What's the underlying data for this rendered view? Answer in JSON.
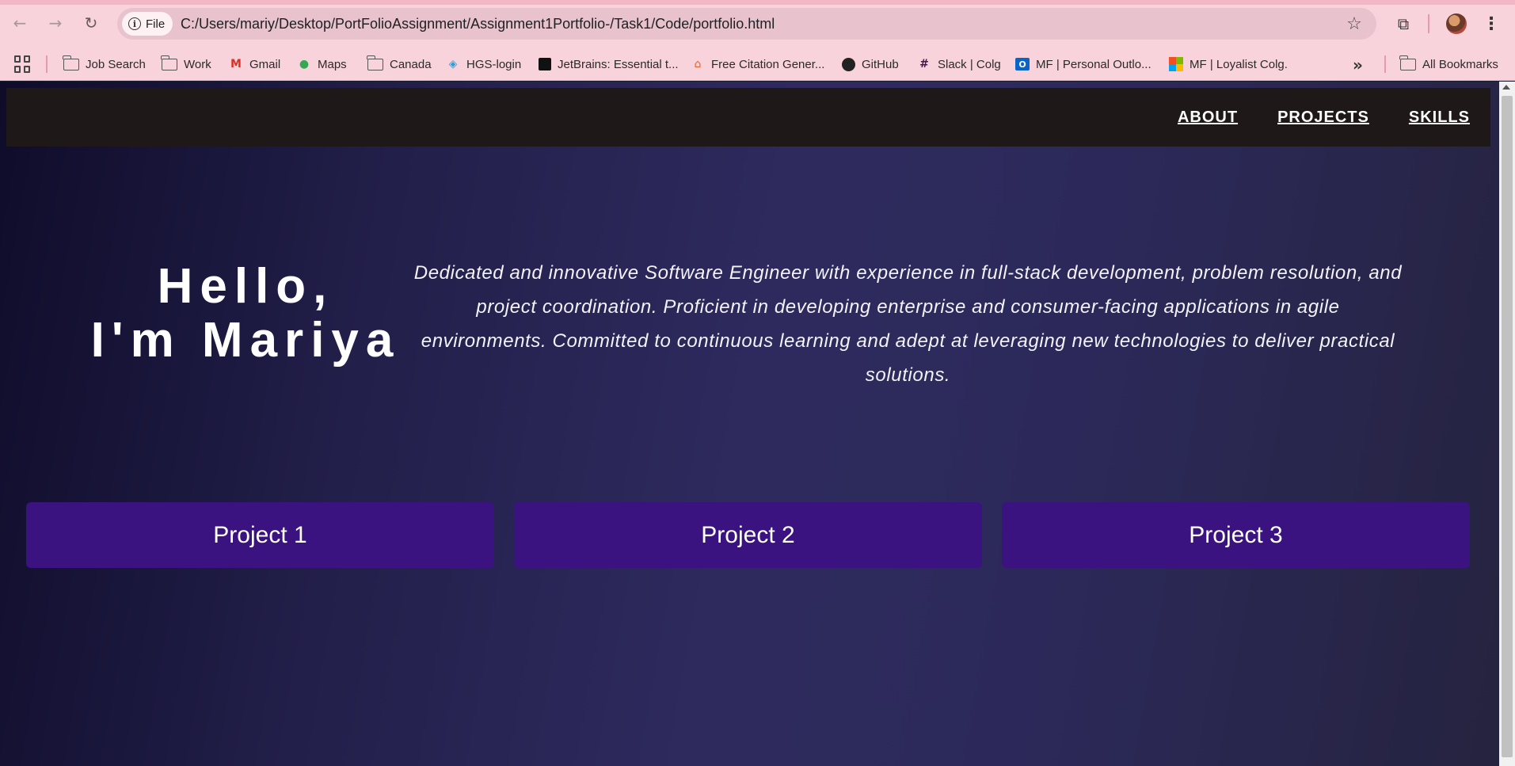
{
  "browser": {
    "url_chip_label": "File",
    "url": "C:/Users/mariy/Desktop/PortFolioAssignment/Assignment1Portfolio-/Task1/Code/portfolio.html",
    "icons": {
      "back": "back-arrow-icon",
      "forward": "forward-arrow-icon",
      "reload": "reload-icon",
      "info": "info-icon",
      "star": "star-icon",
      "extensions": "puzzle-icon",
      "menu": "kebab-menu-icon"
    }
  },
  "bookmarks": {
    "items": [
      {
        "label": "Job Search",
        "icon": "folder-icon"
      },
      {
        "label": "Work",
        "icon": "folder-icon"
      },
      {
        "label": "Gmail",
        "icon": "gmail-icon"
      },
      {
        "label": "Maps",
        "icon": "maps-icon"
      },
      {
        "label": "Canada",
        "icon": "folder-icon"
      },
      {
        "label": "HGS-login",
        "icon": "hgs-icon"
      },
      {
        "label": "JetBrains: Essential t...",
        "icon": "jetbrains-icon"
      },
      {
        "label": "Free Citation Gener...",
        "icon": "citation-icon"
      },
      {
        "label": "GitHub",
        "icon": "github-icon"
      },
      {
        "label": "Slack | Colg",
        "icon": "slack-icon"
      },
      {
        "label": "MF | Personal Outlo...",
        "icon": "outlook-icon"
      },
      {
        "label": "MF | Loyalist Colg.",
        "icon": "microsoft-icon"
      }
    ],
    "all_bookmarks_label": "All Bookmarks"
  },
  "site": {
    "nav": {
      "about": "ABOUT",
      "projects": "PROJECTS",
      "skills": "SKILLS"
    },
    "hero": {
      "heading_line1": "Hello,",
      "heading_line2": "I'm Mariya",
      "description": "Dedicated and innovative Software Engineer with experience in full-stack development, problem resolution, and project coordination. Proficient in developing enterprise and consumer-facing applications in agile environments. Committed to continuous learning and adept at leveraging new technologies to deliver practical solutions."
    },
    "projects": [
      {
        "label": "Project 1"
      },
      {
        "label": "Project 2"
      },
      {
        "label": "Project 3"
      }
    ]
  },
  "colors": {
    "chrome_bg": "#f8d3dc",
    "nav_bg": "#1e1818",
    "project_card": "#3a1380",
    "page_gradient_mid": "#2e2a5e"
  }
}
